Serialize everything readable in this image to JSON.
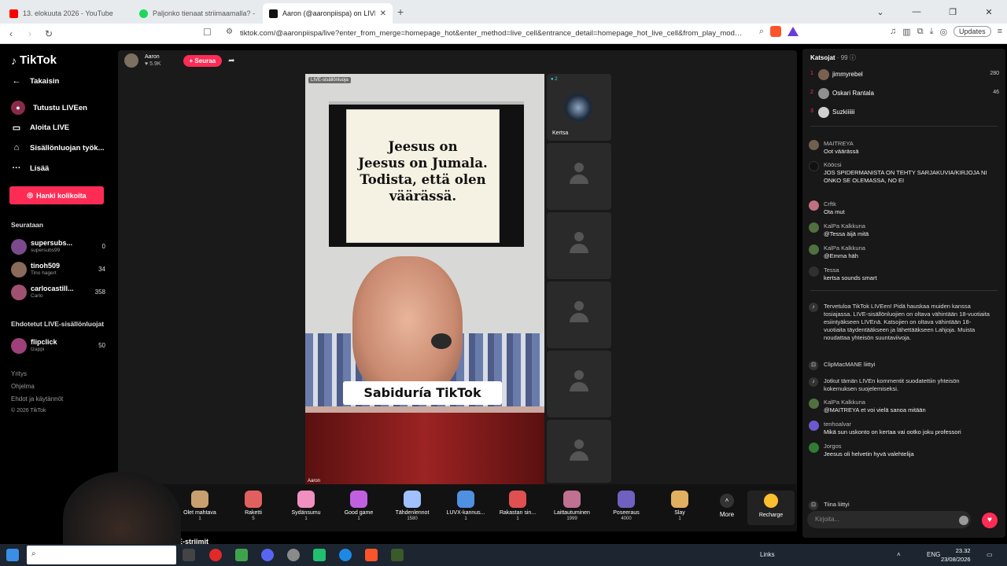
{
  "browser": {
    "tabs": [
      {
        "title": "13. elokuuta 2026 - YouTube",
        "color": "#ff0000"
      },
      {
        "title": "Paljonko tienaat striimaamalla? - La:",
        "color": "#1ed760"
      },
      {
        "title": "Aaron (@aaronpiispa) on LIVE",
        "color": "#111111"
      }
    ],
    "url": "tiktok.com/@aaronpiispa/live?enter_from_merge=homepage_hot&enter_method=live_cell&entrance_detail=homepage_hot_live_cell&from_play_mod…",
    "update_label": "Updates",
    "new_tab": "+"
  },
  "sidebar": {
    "logo": "TikTok",
    "back": "Takaisin",
    "items": [
      {
        "label": "Tutustu LIVEen",
        "icon": "live-icon"
      },
      {
        "label": "Aloita LIVE",
        "icon": "camera-icon"
      },
      {
        "label": "Sisällönluojan työk...",
        "icon": "house-icon"
      },
      {
        "label": "Lisää",
        "icon": "dots-icon"
      }
    ],
    "coins_btn": "Hanki kolikoita",
    "following_title": "Seurataan",
    "following": [
      {
        "name": "supersubs...",
        "sub": "supersubs99",
        "count": "0",
        "color": "#7a4a8a"
      },
      {
        "name": "tinoh509",
        "sub": "Tino hagert",
        "count": "34",
        "color": "#8a6a5a"
      },
      {
        "name": "carlocastill...",
        "sub": "Carlo",
        "count": "358",
        "color": "#a05070"
      }
    ],
    "suggested_title": "Ehdotetut LIVE-sisällönluojat",
    "suggested": [
      {
        "name": "flipclick",
        "sub": "tzappi",
        "count": "50",
        "color": "#a0407a"
      }
    ],
    "footer": [
      "Yritys",
      "Ohjelma",
      "Ehdot ja käytännöt",
      "© 2026 TikTok"
    ]
  },
  "host": {
    "name": "Aaron",
    "likes": "5.9K",
    "follow": "+ Seuraa"
  },
  "video": {
    "tag": "LIVE-sisällönluoja",
    "sign_text": [
      "Jeesus on",
      "Jeesus on Jumala.",
      "Todista, että olen",
      "väärässä."
    ],
    "banner": "Sabiduría TikTok",
    "name": "Aaron"
  },
  "guests": {
    "first_name": "Kertsa",
    "first_count": "2"
  },
  "gifts": [
    {
      "name": "Olet mahtava",
      "price": "1",
      "color": "#c8a070"
    },
    {
      "name": "Raketti",
      "price": "5",
      "color": "#e06060"
    },
    {
      "name": "Sydänsumu",
      "price": "1",
      "color": "#f090c0"
    },
    {
      "name": "Good game",
      "price": "1",
      "color": "#c060e0"
    },
    {
      "name": "Tähdenlennot",
      "price": "1580",
      "color": "#a0c0ff"
    },
    {
      "name": "LUVX-kannus...",
      "price": "1",
      "color": "#5090e0"
    },
    {
      "name": "Rakastan sin...",
      "price": "1",
      "color": "#e05050"
    },
    {
      "name": "Laittautuminen",
      "price": "1999",
      "color": "#c07090"
    },
    {
      "name": "Poseeraus",
      "price": "4000",
      "color": "#7060c0"
    },
    {
      "name": "Slay",
      "price": "1",
      "color": "#e0b060"
    }
  ],
  "gift_more": "More",
  "recharge": "Recharge",
  "live_label": "LIVE-striimit",
  "chat": {
    "viewers_label": "Katsojat",
    "viewers_count": "99",
    "ranking": [
      {
        "rank": "1",
        "name": "jimmyrebel",
        "score": "280",
        "color": "#7a6050"
      },
      {
        "rank": "2",
        "name": "Oskari Rantala",
        "score": "46",
        "color": "#909090"
      },
      {
        "rank": "3",
        "name": "Suzkiiiiii",
        "score": "",
        "color": "#d0d0d0"
      }
    ],
    "messages": [
      {
        "user": "MAITREYA",
        "text": "Oot väärässä",
        "color": "#706050"
      },
      {
        "user": "Kööcsi",
        "text": "JOS SPIDERMANISTA ON TEHTY SARJAKUVIA/KIRJOJA NI ONKO SE OLEMASSA, NO EI",
        "color": "#111111"
      },
      {
        "user": "Crftk",
        "text": "Ota mut",
        "color": "#c07080"
      },
      {
        "user": "KalPa Kalkkuna",
        "text": "@Tessa äijä mitä",
        "color": "#507040"
      },
      {
        "user": "KalPa Kalkkuna",
        "text": "@Emma häh",
        "color": "#507040"
      },
      {
        "user": "Tessa",
        "text": "kertsa sounds smart",
        "color": "#303030"
      }
    ],
    "welcome": "Tervetuloa TikTok LIVEen! Pidä hauskaa muiden kanssa tosiajassa. LIVE-sisällönluojien on oltava vähintään 18-vuotiaita esiintyäkseen LIVEnä. Katsojien on oltava vähintään 18-vuotiaita täydentääkseen ja lähettääkseen Lahjoja. Muista noudattaa yhteisön suuntaviivoja.",
    "joined1": "ClipMacMANE  liittyi",
    "filtered": "Jotkut tämän LIVEn kommentit suodatettiin yhteisön kokemuksen suojelemiseksi.",
    "messages2": [
      {
        "user": "KalPa Kalkkuna",
        "text": "@MAITREYA et voi vielä sanoa mitään",
        "color": "#507040"
      },
      {
        "user": "tenhoalvar",
        "text": "Mikä sun uskonto on kertaa vai ootko joku professori",
        "color": "#6a5acd"
      },
      {
        "user": "Jorgos",
        "text": "Jeesus oli helvetin hyvä valehtelija",
        "color": "#2e7d32"
      }
    ],
    "joined2": "Tiina  liittyi",
    "input_placeholder": "Kirjoita..."
  },
  "taskbar": {
    "links": "Links",
    "lang": "ENG",
    "time": "23.32",
    "date": "23/08/2026"
  }
}
